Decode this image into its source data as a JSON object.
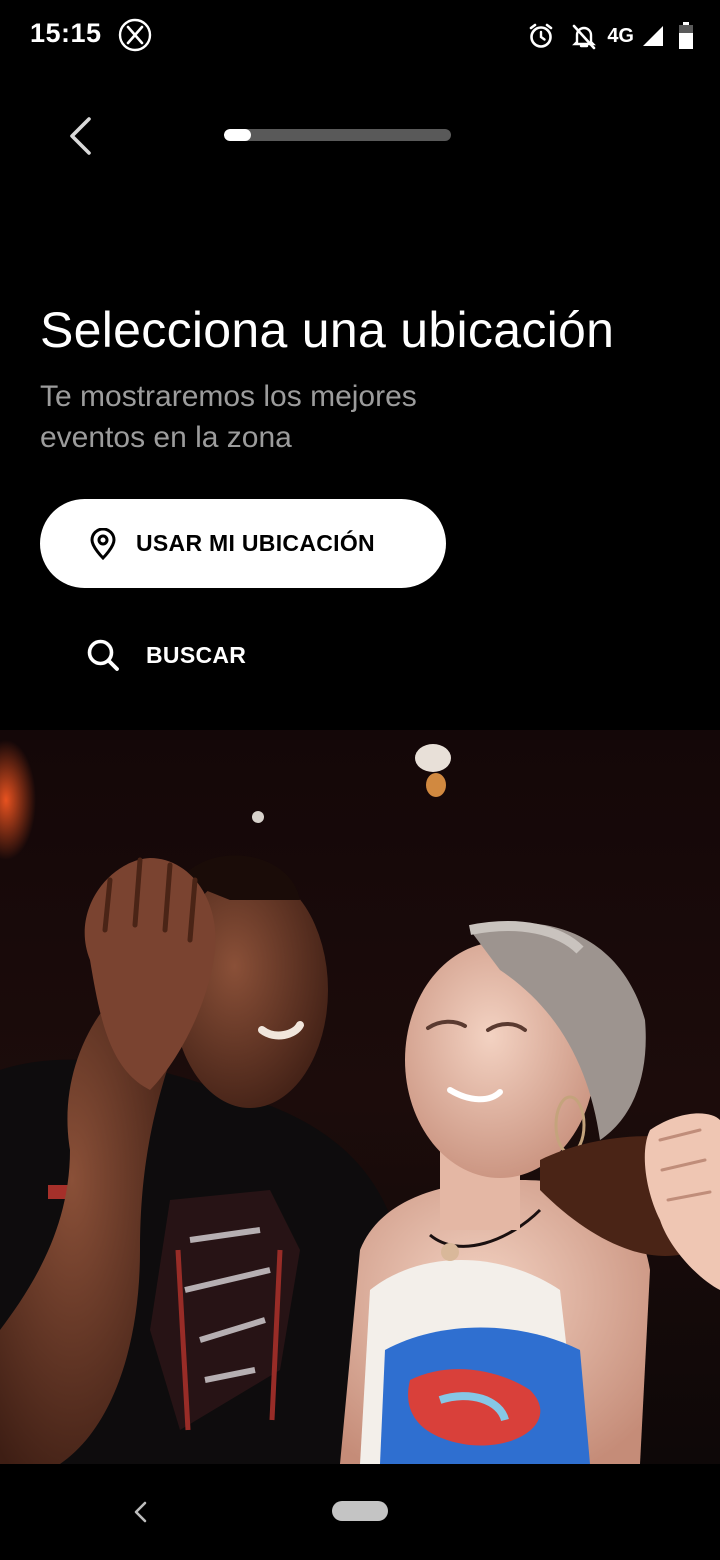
{
  "status_bar": {
    "time": "15:15",
    "network": "4G",
    "icons": [
      "x-app-icon",
      "alarm-icon",
      "notifications-off-icon",
      "signal-icon",
      "battery-icon"
    ]
  },
  "header": {
    "back_icon": "chevron-left-icon",
    "progress": 0.12
  },
  "main": {
    "title": "Selecciona una ubicación",
    "subtitle": "Te mostraremos los mejores eventos en la zona",
    "use_location_button": {
      "label": "USAR MI UBICACIÓN",
      "icon": "location-pin-icon"
    },
    "search_button": {
      "label": "BUSCAR",
      "icon": "search-icon"
    }
  },
  "hero_image": {
    "icon": "photo-couple-dancing"
  },
  "system_nav": {
    "back_icon": "nav-back-icon",
    "home_icon": "home-pill-icon"
  },
  "colors": {
    "background": "#000000",
    "text_primary": "#ffffff",
    "text_secondary": "#9c9c9c",
    "button_bg": "#ffffff",
    "progress_track": "#595959"
  }
}
